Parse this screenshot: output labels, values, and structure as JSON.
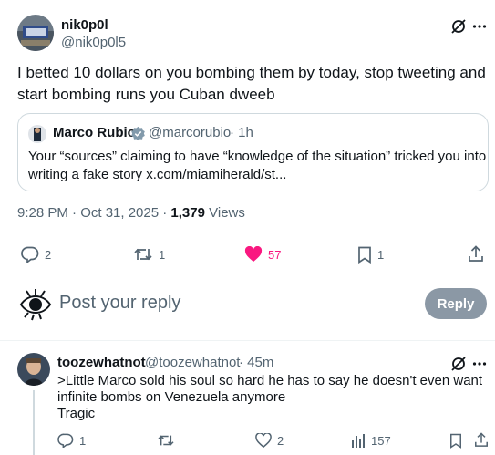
{
  "main_tweet": {
    "display_name": "nik0p0l",
    "handle": "@nik0p0l5",
    "text_line1": "I betted 10 dollars on you bombing them by today, stop tweeting and",
    "text_line2": "start bombing runs you Cuban dweeb",
    "timestamp": "9:28 PM · Oct 31, 2025 ·",
    "views_count": "1,379",
    "views_label": "Views"
  },
  "quote": {
    "display_name": "Marco Rubio",
    "handle": "@marcorubio",
    "time": "· 1h",
    "text_line1": "Your “sources” claiming to have “knowledge of the situation” tricked you into",
    "text_line2": "writing a fake story x.com/miamiherald/st..."
  },
  "actions": {
    "replies": "2",
    "reposts": "1",
    "likes": "57",
    "bookmarks": "1"
  },
  "composer": {
    "placeholder": "Post your reply",
    "reply_label": "Reply"
  },
  "reply_tweet": {
    "display_name": "toozewhatnot",
    "handle": "@toozewhatnot",
    "time": "· 45m",
    "text_line1": ">Little Marco sold his soul so hard he  has to say he doesn't even want",
    "text_line2": "infinite bombs on Venezuela anymore",
    "text_line3": "Tragic",
    "replies": "1",
    "likes": "2",
    "views": "157"
  },
  "colors": {
    "text": "#0f1419",
    "muted": "#536471",
    "like_active": "#f91880",
    "verified": "#829aab",
    "reply_button": "#8b98a5",
    "border": "#cfd9de"
  }
}
